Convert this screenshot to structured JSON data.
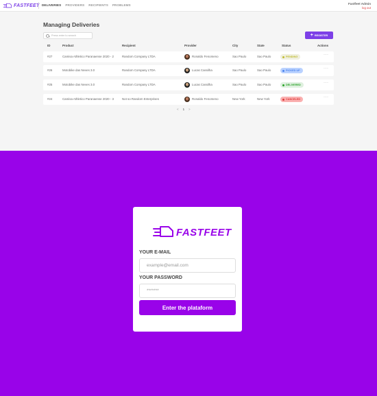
{
  "header": {
    "logo_text": "FASTFEET",
    "nav": [
      "DELIVERIES",
      "PROVIDERS",
      "RECIPIENTS",
      "PROBLEMS"
    ],
    "user_name": "Fastfeet Admin",
    "logout": "log out"
  },
  "main": {
    "title": "Managing Deliveries",
    "search_placeholder": "Press enter to search",
    "register_label": "REGISTER",
    "columns": [
      "ID",
      "Product",
      "Recipient",
      "Provider",
      "City",
      "State",
      "Status",
      "Actions"
    ],
    "rows": [
      {
        "id": "#27",
        "product": "Camisa Athletico Paranaense 2020 - 2",
        "recipient": "Random Company LTDA",
        "provider": "Ronaldo Fenomeno",
        "city": "Sao Paulo",
        "state": "Sao Paulo",
        "status": "PENDING",
        "status_bg": "#f0f0df",
        "status_fg": "#c1bc35",
        "actions": "···"
      },
      {
        "id": "#26",
        "product": "Motobike das Neves 3.0",
        "recipient": "Random Company LTDA",
        "provider": "Lucas Cassilha",
        "city": "Sao Paulo",
        "state": "Sao Paulo",
        "status": "PICKED UP",
        "status_bg": "#bad2ff",
        "status_fg": "#4d85ee",
        "actions": "···"
      },
      {
        "id": "#25",
        "product": "Motobike das Neves 3.0",
        "recipient": "Random Company LTDA",
        "provider": "Lucas Cassilha",
        "city": "Sao Paulo",
        "state": "Sao Paulo",
        "status": "DELIVERED",
        "status_bg": "#dff0df",
        "status_fg": "#2ca42b",
        "actions": "···"
      },
      {
        "id": "#24",
        "product": "Camisa Athletico Paranaense 2020 - 3",
        "recipient": "Not so Random Enterprises",
        "provider": "Ronaldo Fenomeno",
        "city": "New York",
        "state": "New York",
        "status": "CANCELED",
        "status_bg": "#fab0b0",
        "status_fg": "#de3b3b",
        "actions": "···"
      }
    ],
    "pager": {
      "prev": "<",
      "page": "1",
      "next": ">"
    }
  },
  "login": {
    "brand": "FASTFEET",
    "email_label": "YOUR E-MAIL",
    "email_placeholder": "example@email.com",
    "password_label": "YOUR PASSWORD",
    "password_placeholder": "*******",
    "submit_label": "Enter the plataform"
  },
  "colors": {
    "accent": "#7d40e7",
    "login_bg": "#9903e9",
    "danger": "#de3b3b"
  }
}
